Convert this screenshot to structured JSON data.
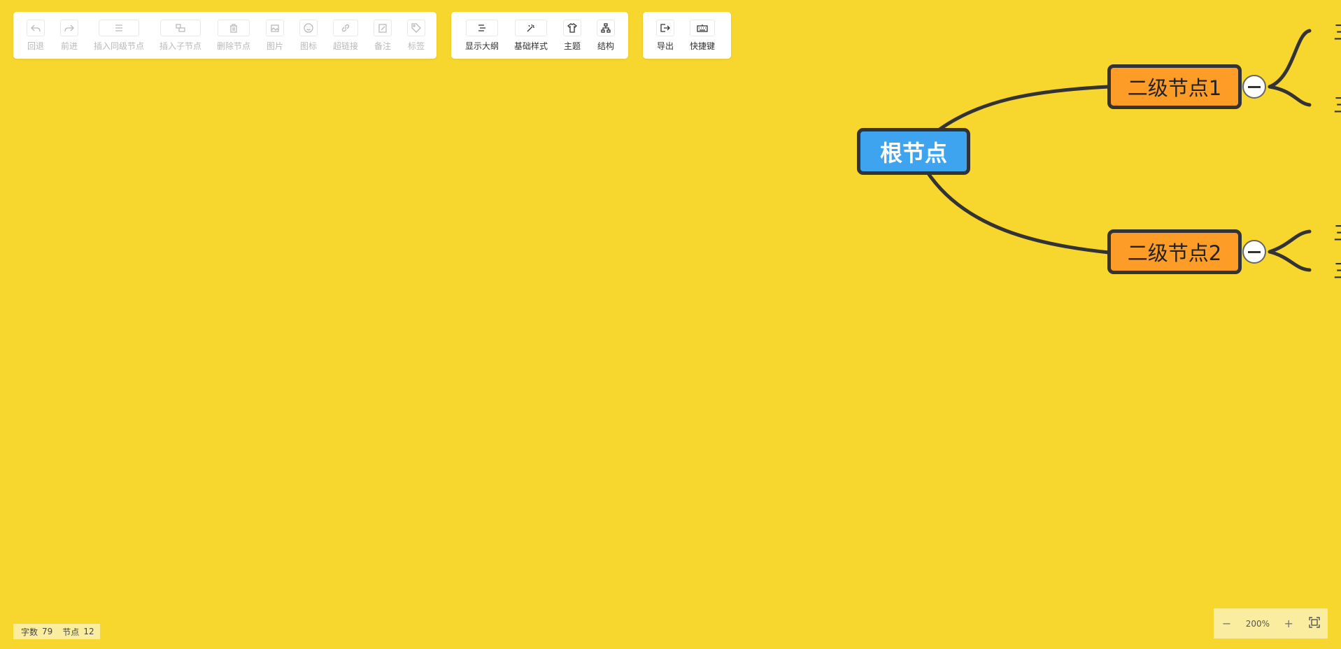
{
  "toolbar": {
    "edit": [
      {
        "label": "回退",
        "icon": "undo-icon"
      },
      {
        "label": "前进",
        "icon": "redo-icon"
      },
      {
        "label": "插入同级节点",
        "icon": "sibling-node-icon"
      },
      {
        "label": "插入子节点",
        "icon": "child-node-icon"
      },
      {
        "label": "删除节点",
        "icon": "trash-icon"
      },
      {
        "label": "图片",
        "icon": "image-icon"
      },
      {
        "label": "图标",
        "icon": "smiley-icon"
      },
      {
        "label": "超链接",
        "icon": "link-icon"
      },
      {
        "label": "备注",
        "icon": "note-icon"
      },
      {
        "label": "标签",
        "icon": "tag-icon"
      }
    ],
    "view": [
      {
        "label": "显示大纲",
        "icon": "outline-icon"
      },
      {
        "label": "基础样式",
        "icon": "magic-wand-icon"
      },
      {
        "label": "主题",
        "icon": "shirt-icon"
      },
      {
        "label": "结构",
        "icon": "structure-icon"
      }
    ],
    "file": [
      {
        "label": "导出",
        "icon": "export-icon"
      },
      {
        "label": "快捷键",
        "icon": "keyboard-icon"
      }
    ]
  },
  "mindmap": {
    "root": "根节点",
    "children": [
      {
        "label": "二级节点1"
      },
      {
        "label": "二级节点2"
      }
    ],
    "truncated_child_glyph": "三"
  },
  "status": {
    "word_count_label": "字数",
    "word_count": "79",
    "node_count_label": "节点",
    "node_count": "12"
  },
  "zoom": {
    "minus": "−",
    "level": "200%",
    "plus": "+"
  },
  "colors": {
    "background": "#f7d72e",
    "root_fill": "#3fa4ef",
    "secondary_fill": "#fd9c26",
    "line": "#333333"
  }
}
